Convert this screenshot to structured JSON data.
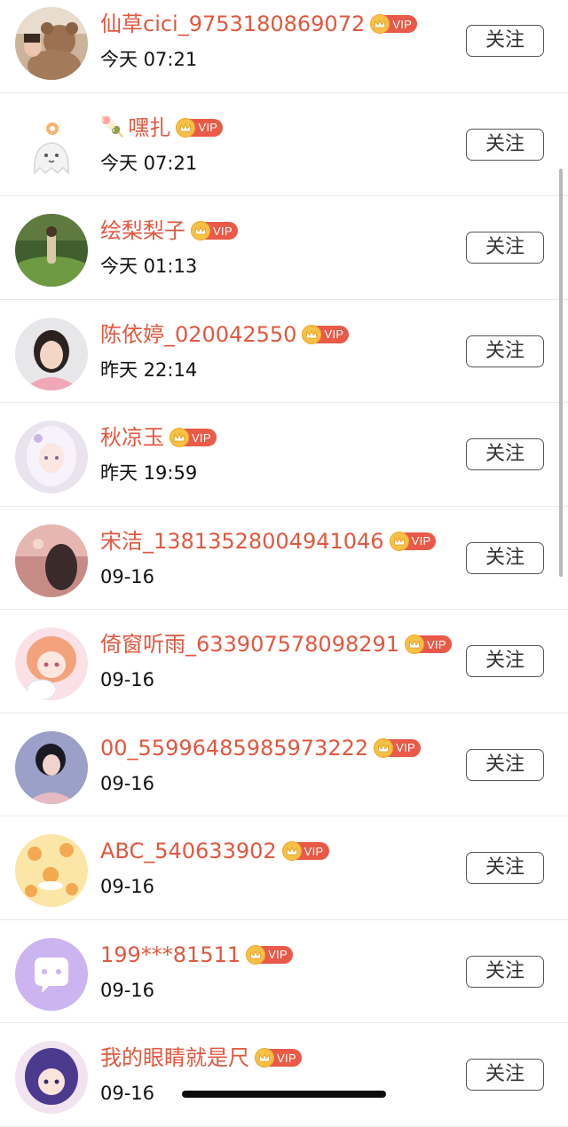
{
  "follow_label": "关注",
  "vip_label": "VIP",
  "colors": {
    "name": "#e2573e",
    "vip_badge": "#e95a48",
    "crown": "#f6c146",
    "divider": "#e9e9e9",
    "button_border": "#555555"
  },
  "users": [
    {
      "name": "仙草cici_9753180869072",
      "time": "今天 07:21",
      "avatar_icon": "teddy-bear-photo",
      "prefix_emoji": ""
    },
    {
      "name": "嘿扎",
      "time": "今天 07:21",
      "avatar_icon": "cartoon-ghost-sun",
      "prefix_emoji": "🍡"
    },
    {
      "name": "绘梨梨子",
      "time": "今天 01:13",
      "avatar_icon": "girl-in-meadow-photo",
      "prefix_emoji": ""
    },
    {
      "name": "陈依婷_020042550",
      "time": "昨天 22:14",
      "avatar_icon": "girl-portrait-photo",
      "prefix_emoji": ""
    },
    {
      "name": "秋凉玉",
      "time": "昨天 19:59",
      "avatar_icon": "anime-girl-white-hair",
      "prefix_emoji": ""
    },
    {
      "name": "宋洁_13813528004941046",
      "time": "09-16",
      "avatar_icon": "girl-sunset-photo",
      "prefix_emoji": ""
    },
    {
      "name": "倚窗听雨_633907578098291",
      "time": "09-16",
      "avatar_icon": "anime-girl-cinnamoroll",
      "prefix_emoji": ""
    },
    {
      "name": "00_55996485985973222",
      "time": "09-16",
      "avatar_icon": "short-hair-woman-photo",
      "prefix_emoji": ""
    },
    {
      "name": "ABC_540633902",
      "time": "09-16",
      "avatar_icon": "cartoon-pattern",
      "prefix_emoji": ""
    },
    {
      "name": "199***81511",
      "time": "09-16",
      "avatar_icon": "chat-bubble-icon",
      "prefix_emoji": ""
    },
    {
      "name": "我的眼睛就是尺",
      "time": "09-16",
      "avatar_icon": "anime-girl-purple-hair",
      "prefix_emoji": ""
    }
  ]
}
